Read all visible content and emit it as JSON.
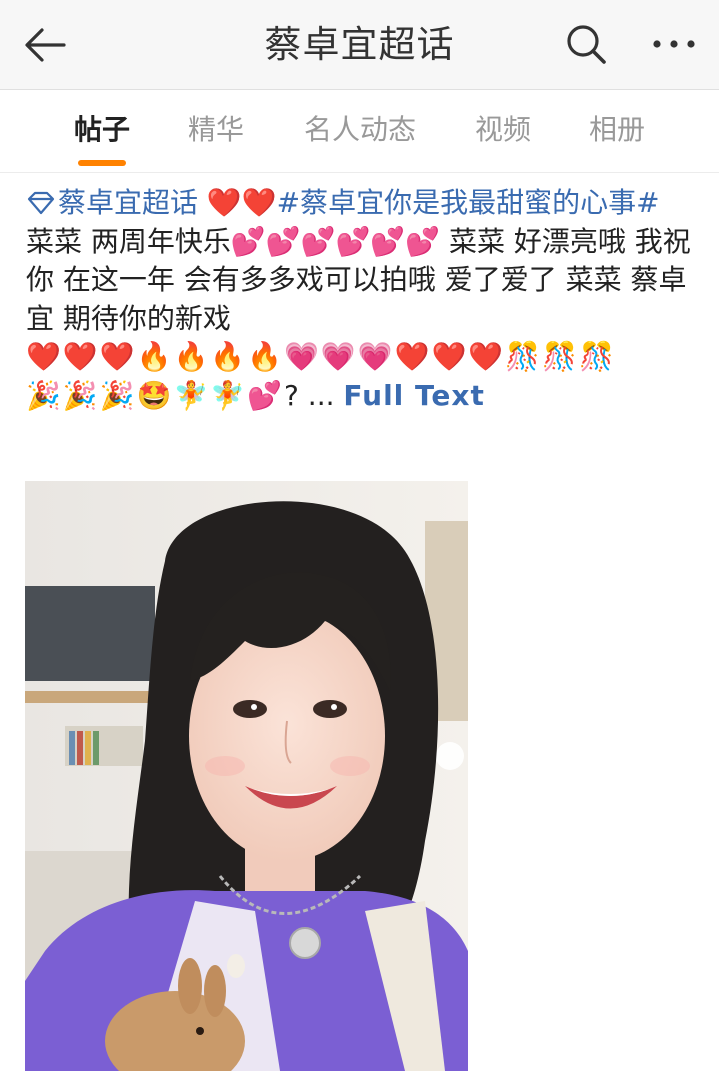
{
  "header": {
    "title": "蔡卓宜超话",
    "back_icon": "arrow-left-icon",
    "search_icon": "search-icon",
    "more_icon": "more-dots-icon"
  },
  "tabs": [
    {
      "label": "帖子",
      "active": true
    },
    {
      "label": "精华",
      "active": false
    },
    {
      "label": "名人动态",
      "active": false
    },
    {
      "label": "视频",
      "active": false
    },
    {
      "label": "相册",
      "active": false
    }
  ],
  "colors": {
    "accent": "#ff8200",
    "link": "#3a6bb0",
    "header_bg": "#f7f7f7"
  },
  "post": {
    "topic": "蔡卓宜超话",
    "topic_icon": "super-topic-diamond-icon",
    "hearts_after_topic": "❤️❤️",
    "hashtag": "#蔡卓宜你是我最甜蜜的心事#",
    "text_part1": "菜菜 两周年快乐",
    "emoji_two_hearts": "💕💕💕💕💕💕",
    "text_part2": " 菜菜 好漂亮哦 我祝你 在这一年 会有多多戏可以拍哦 爱了爱了 菜菜 蔡卓宜 期待你的新戏",
    "emoji_line1": "❤️❤️❤️🔥🔥🔥🔥💗💗💗❤️❤️❤️🎊🎊🎊",
    "emoji_line2": "🎉🎉🎉🤩🧚🧚💕",
    "ellipsis": "? ...",
    "full_text_label": "Full Text",
    "photo_desc_icon": "post-photo"
  }
}
